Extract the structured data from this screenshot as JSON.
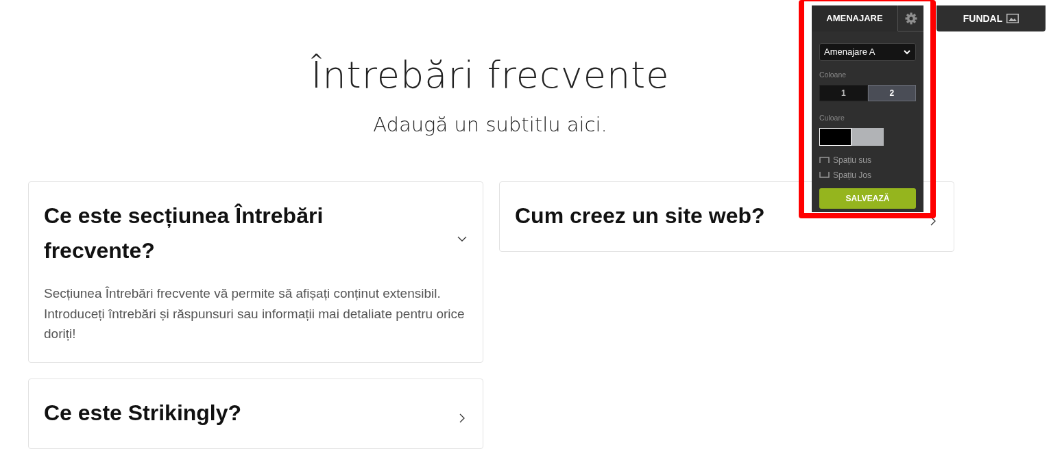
{
  "header": {
    "title": "Întrebări frecvente",
    "subtitle": "Adaugă un subtitlu aici."
  },
  "faq": {
    "columns": [
      {
        "items": [
          {
            "question": "Ce este secțiunea Întrebări frecvente?",
            "expanded": true,
            "answer": "Secțiunea Întrebări frecvente vă permite să afișați conținut extensibil. Introduceți întrebări și răspunsuri sau informații mai detaliate pentru orice doriți!"
          },
          {
            "question": "Ce este Strikingly?",
            "expanded": false
          }
        ]
      },
      {
        "items": [
          {
            "question": "Cum creez un site web?",
            "expanded": false
          }
        ]
      }
    ]
  },
  "editor": {
    "tabs": [
      {
        "kind": "text",
        "label": "AMENAJARE",
        "selected": true
      },
      {
        "kind": "gear",
        "selected": false
      }
    ],
    "background_button": {
      "label": "FUNDAL"
    },
    "layout_select": {
      "value": "Amenajare A"
    },
    "columns_label": "Coloane",
    "columns_options": [
      {
        "label": "1",
        "selected": false
      },
      {
        "label": "2",
        "selected": true
      }
    ],
    "color_label": "Culoare",
    "swatches": [
      {
        "color": "#000000",
        "selected": true
      },
      {
        "color": "#b1b3b6",
        "selected": false
      }
    ],
    "spacing": [
      {
        "kind": "top",
        "label": "Spațiu sus",
        "checked": false
      },
      {
        "kind": "bottom",
        "label": "Spațiu Jos",
        "checked": false
      }
    ],
    "save_button": {
      "label": "SALVEAZĂ"
    }
  }
}
